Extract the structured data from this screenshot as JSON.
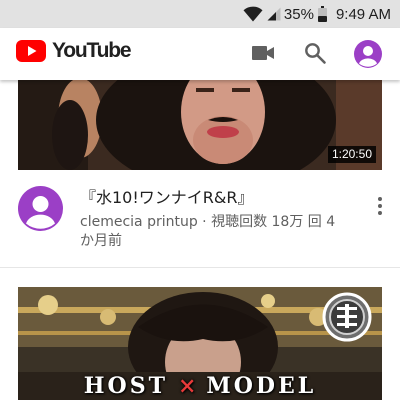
{
  "status_bar": {
    "battery_percent": "35%",
    "time": "9:49 AM"
  },
  "app_bar": {
    "logo_text": "YouTube"
  },
  "videos": [
    {
      "duration": "1:20:50",
      "title": "『水10!ワンナイR&R』",
      "channel": "clemecia printup",
      "subtitle": "clemecia printup · 視聴回数 18万 回 4 か月前"
    },
    {
      "overlay_left": "HOST",
      "overlay_mid": "×",
      "overlay_right": "MODEL"
    }
  ],
  "colors": {
    "youtube_red": "#ff0000",
    "avatar_purple": "#9b3fc6",
    "status_bar_bg": "#e2e2e2"
  },
  "icons": [
    "wifi-icon",
    "signal-icon",
    "battery-icon",
    "video-camera-icon",
    "search-icon",
    "account-avatar-icon",
    "more-vert-icon"
  ]
}
